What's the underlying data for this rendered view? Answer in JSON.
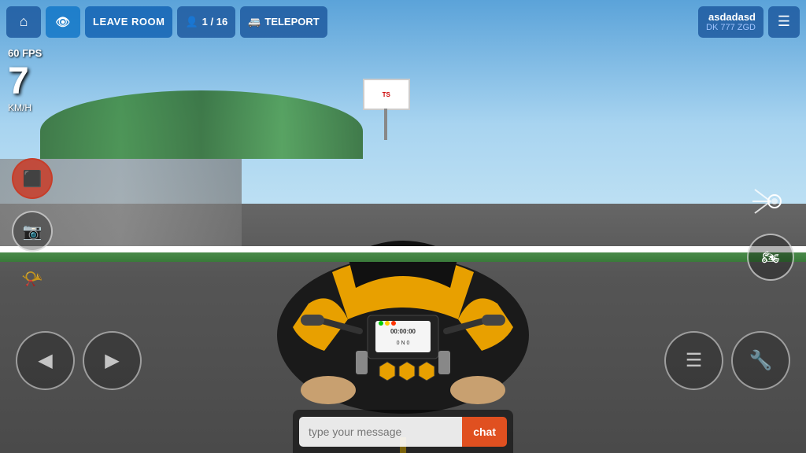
{
  "hud": {
    "home_label": "⌂",
    "eye_label": "👁",
    "leave_room_label": "LEAVE ROOM",
    "players_current": "1",
    "players_separator": "/",
    "players_max": "16",
    "teleport_label": "TELEPORT",
    "player_name": "asdadasd",
    "player_plate": "DK 777 ZGD",
    "menu_icon": "☰",
    "fps_label": "60 FPS",
    "speed_value": "7",
    "speed_unit": "KM/H"
  },
  "chat": {
    "input_placeholder": "type your message",
    "send_button_label": "chat"
  },
  "controls": {
    "left_arrow": "◀",
    "right_arrow": "▶",
    "camera_icon": "📷",
    "horn_icon": "📯",
    "headlight_icon": "◈",
    "moto_icon": "🏍",
    "list_icon": "☰",
    "throttle_icon": "🔧"
  },
  "billboard": {
    "text": "TS"
  },
  "colors": {
    "hud_bg": "rgba(30, 90, 160, 0.85)",
    "chat_send_bg": "#e05020",
    "red_btn": "#c83c28"
  }
}
